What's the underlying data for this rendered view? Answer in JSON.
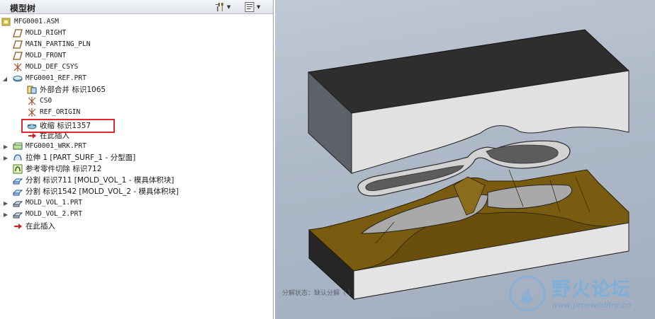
{
  "tree_panel": {
    "title": "模型树",
    "settings_icon": "tools-icon",
    "columns_icon": "list-settings-icon"
  },
  "tree_items": [
    {
      "label": "MFG0001.ASM",
      "icon": "assembly-icon",
      "expander": "none"
    },
    {
      "label": "MOLD_RIGHT",
      "icon": "datum-plane-icon",
      "expander": "none"
    },
    {
      "label": "MAIN_PARTING_PLN",
      "icon": "datum-plane-icon",
      "expander": "none"
    },
    {
      "label": "MOLD_FRONT",
      "icon": "datum-plane-icon",
      "expander": "none"
    },
    {
      "label": "MOLD_DEF_CSYS",
      "icon": "coordinate-system-icon",
      "expander": "none"
    },
    {
      "label": "MFG0001_REF.PRT",
      "icon": "reference-part-icon",
      "expander": "expanded"
    },
    {
      "label": "外部合并 标识1065",
      "icon": "merge-icon",
      "expander": "none"
    },
    {
      "label": "CS0",
      "icon": "coordinate-system-icon",
      "expander": "none"
    },
    {
      "label": "REF_ORIGIN",
      "icon": "coordinate-system-icon",
      "expander": "none"
    },
    {
      "label": "收缩 标识1357",
      "icon": "shrinkage-icon",
      "expander": "none"
    },
    {
      "label": "在此插入",
      "icon": "insert-here-arrow-icon",
      "expander": "none"
    },
    {
      "label": "MFG0001_WRK.PRT",
      "icon": "workpiece-part-icon",
      "expander": "collapsed"
    },
    {
      "label": "拉伸 1 [PART_SURF_1 - 分型面]",
      "icon": "extrude-surface-icon",
      "expander": "collapsed"
    },
    {
      "label": "参考零件切除 标识712",
      "icon": "reference-part-cutout-icon",
      "expander": "none"
    },
    {
      "label": "分割 标识711 [MOLD_VOL_1 - 模具体积块]",
      "icon": "split-volume-icon",
      "expander": "none"
    },
    {
      "label": "分割 标识1542 [MOLD_VOL_2 - 模具体积块]",
      "icon": "split-volume-icon",
      "expander": "none"
    },
    {
      "label": "MOLD_VOL_1.PRT",
      "icon": "mold-part-icon",
      "expander": "collapsed"
    },
    {
      "label": "MOLD_VOL_2.PRT",
      "icon": "mold-part-icon",
      "expander": "collapsed"
    },
    {
      "label": "在此插入",
      "icon": "insert-here-arrow-icon",
      "expander": "none"
    }
  ],
  "viewport": {
    "explode_status": "分解状态：缺认分解（ ）",
    "watermark_title": "野火论坛",
    "watermark_url": "www.proewildfire.cn"
  },
  "colors": {
    "mold_gray": "#e3e3e3",
    "mold_dark": "#2f2f2f",
    "cavity_bronze": "#7a5c10",
    "highlight_red": "#e0282e"
  }
}
